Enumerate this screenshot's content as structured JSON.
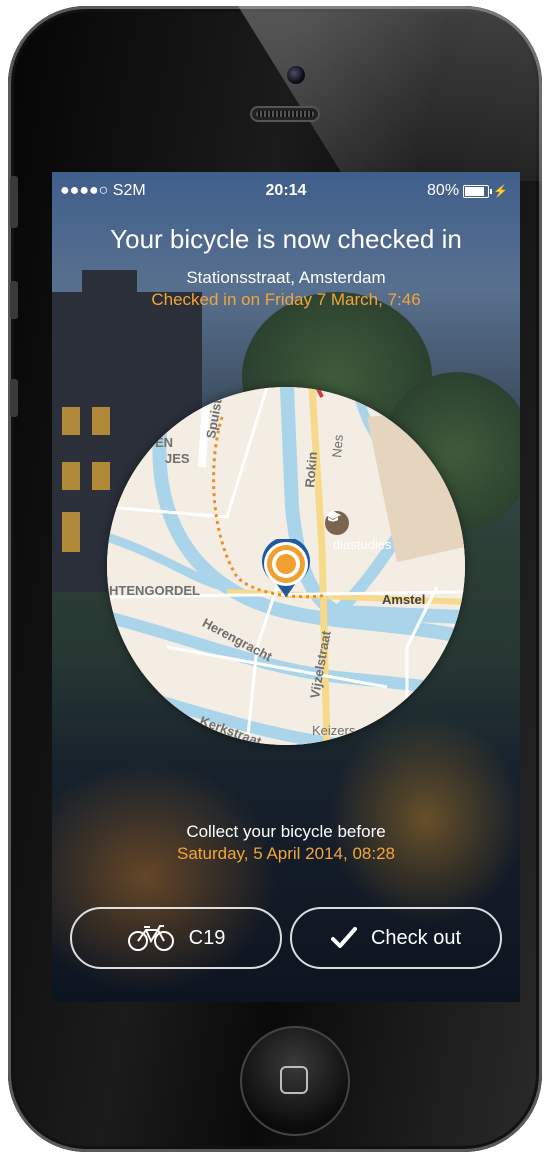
{
  "status_bar": {
    "carrier": "●●●●○ S2M",
    "time": "20:14",
    "battery": "80%"
  },
  "header": {
    "title": "Your bicycle is now checked in",
    "address": "Stationsstraat, Amsterdam",
    "checked_in": "Checked in on Friday 7 March, 7:46"
  },
  "map": {
    "labels": {
      "spuistraat": "Spuistraat",
      "rokin": "Rokin",
      "nes": "Nes",
      "jes": "JES",
      "en": "EN",
      "grachtengordel": "HTENGORDEL",
      "mediastudies": "diastudies",
      "amstel": "Amstel",
      "herengracht": "Herengracht",
      "vijzelstraat": "Vijzelstraat",
      "keizersgracht": "Keizers",
      "kerkstraat": "Kerkstraat"
    },
    "icons": {
      "pin": "location-pin-icon",
      "poi": "graduation-cap-icon"
    }
  },
  "collect": {
    "label": "Collect your bicycle before",
    "date": "Saturday, 5 April 2014, 08:28"
  },
  "buttons": {
    "bike_id": "C19",
    "checkout": "Check out"
  },
  "colors": {
    "accent": "#f2a53a",
    "text": "#ffffff",
    "pin": "#1f5a9e"
  }
}
